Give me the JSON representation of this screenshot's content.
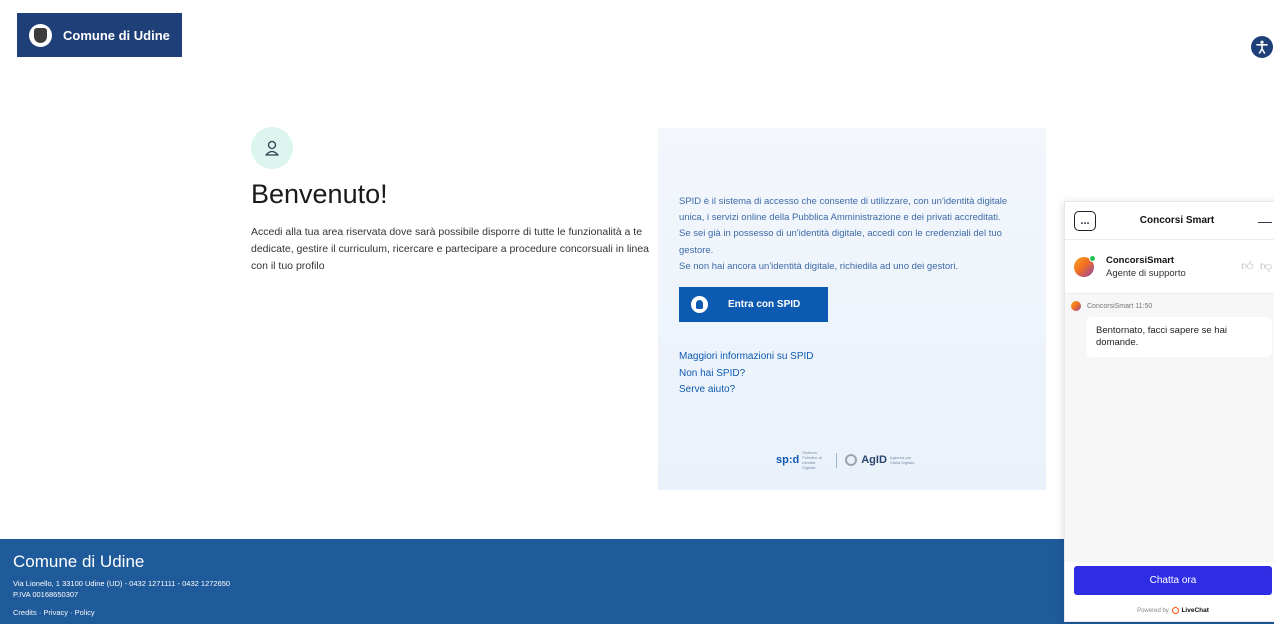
{
  "header": {
    "brand_name": "Comune di Udine",
    "crest_icon": "city-crest-icon",
    "accessibility_icon": "accessibility-icon"
  },
  "welcome": {
    "title": "Benvenuto!",
    "text": "Accedi alla tua area riservata dove sarà possibile disporre di tutte le funzionalità a te dedicate, gestire il curriculum, ricercare e partecipare a procedure concorsuali in linea con il tuo profilo"
  },
  "spid": {
    "description_1": "SPID è il sistema di accesso che consente di utilizzare, con un'identità digitale unica, i servizi online della Pubblica Amministrazione e dei privati accreditati.",
    "description_2": "Se sei già in possesso di un'identità digitale, accedi con le credenziali del tuo gestore.",
    "description_3": "Se non hai ancora un'identità digitale, richiedila ad uno dei gestori.",
    "button_label": "Entra con SPID",
    "links": [
      "Maggiori informazioni su SPID",
      "Non hai SPID?",
      "Serve aiuto?"
    ],
    "logo_spid": "sp:d",
    "logo_spid_sub": "Sistema Pubblico di Identità Digitale",
    "logo_agid": "AgID",
    "logo_agid_sub": "Agenzia per l'Italia Digitale"
  },
  "footer": {
    "name": "Comune di Udine",
    "address": "Via Lionello, 1 33100 Udine (UD) - 0432 1271111 - 0432 1272650",
    "vat": "P.IVA 00168650307",
    "links": "Credits · Privacy · Policy"
  },
  "chat": {
    "title": "Concorsi Smart",
    "menu_label": "...",
    "minimize": "—",
    "agent_name": "ConcorsiSmart",
    "agent_role": "Agente di supporto",
    "message_author": "ConcorsiSmart",
    "message_time": "11:50",
    "message_text": "Bentornato, facci sapere se hai domande.",
    "cta_label": "Chatta ora",
    "powered_prefix": "Powered by",
    "powered_brand": "LiveChat"
  },
  "colors": {
    "brand_blue": "#1f3f78",
    "spid_blue": "#0d5ab3",
    "footer_blue": "#1f5a9a",
    "chat_cta": "#2f2de4"
  }
}
